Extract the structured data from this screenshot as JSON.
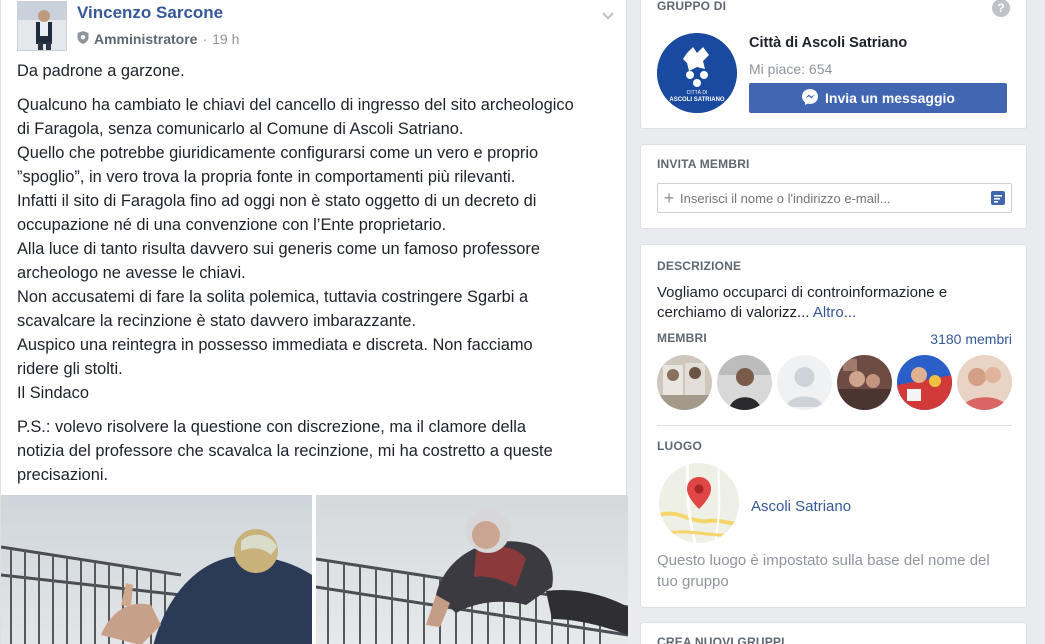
{
  "post": {
    "author": "Vincenzo Sarcone",
    "role": "Amministratore",
    "separator": "·",
    "time": "19 h",
    "title_line": "Da padrone a garzone.",
    "paragraph1": [
      "Qualcuno ha cambiato le chiavi del cancello di ingresso del sito archeologico",
      "di Faragola, senza comunicarlo al Comune di Ascoli Satriano.",
      "Quello che potrebbe giuridicamente configurarsi come un vero e proprio",
      "”spoglio”, in vero trova la propria fonte in comportamenti più rilevanti.",
      "Infatti il sito di Faragola fino ad oggi non è stato oggetto di un decreto di",
      "occupazione né di una convenzione con l’Ente proprietario.",
      "Alla luce di tanto risulta davvero sui generis come un famoso professore",
      "archeologo ne avesse le chiavi.",
      "Non accusatemi di fare la solita polemica, tuttavia costringere Sgarbi a",
      "scavalcare la recinzione è stato davvero imbarazzante.",
      "Auspico una reintegra in possesso immediata e discreta. Non facciamo",
      "ridere gli stolti.",
      "Il Sindaco"
    ],
    "paragraph2": [
      "P.S.: volevo risolvere la questione con discrezione, ma il clamore della",
      "notizia del professore che scavalca la recinzione, mi ha costretto a queste",
      "precisazioni."
    ]
  },
  "group_card": {
    "heading": "GRUPPO DI",
    "help": "?",
    "name": "Città di Ascoli Satriano",
    "likes": "Mi piace: 654",
    "message_button": "Invia un messaggio",
    "logo_text_top": "CITTÀ DI",
    "logo_text_bottom": "ASCOLI SATRIANO"
  },
  "invite": {
    "heading": "INVITA MEMBRI",
    "placeholder": "Inserisci il nome o l'indirizzo e-mail..."
  },
  "about": {
    "description_heading": "DESCRIZIONE",
    "description": "Vogliamo occuparci di controinformazione e cerchiamo di valorizz...",
    "more_link": "Altro...",
    "members_heading": "MEMBRI",
    "members_count": "3180 membri",
    "location_heading": "LUOGO",
    "location_name": "Ascoli Satriano",
    "location_note": "Questo luogo è impostato sulla base del nome del tuo gruppo"
  },
  "create": {
    "heading": "CREA NUOVI GRUPPI"
  },
  "colors": {
    "link": "#365899",
    "button": "#4267b2",
    "muted": "#90949c",
    "logo": "#1a4aa0"
  }
}
